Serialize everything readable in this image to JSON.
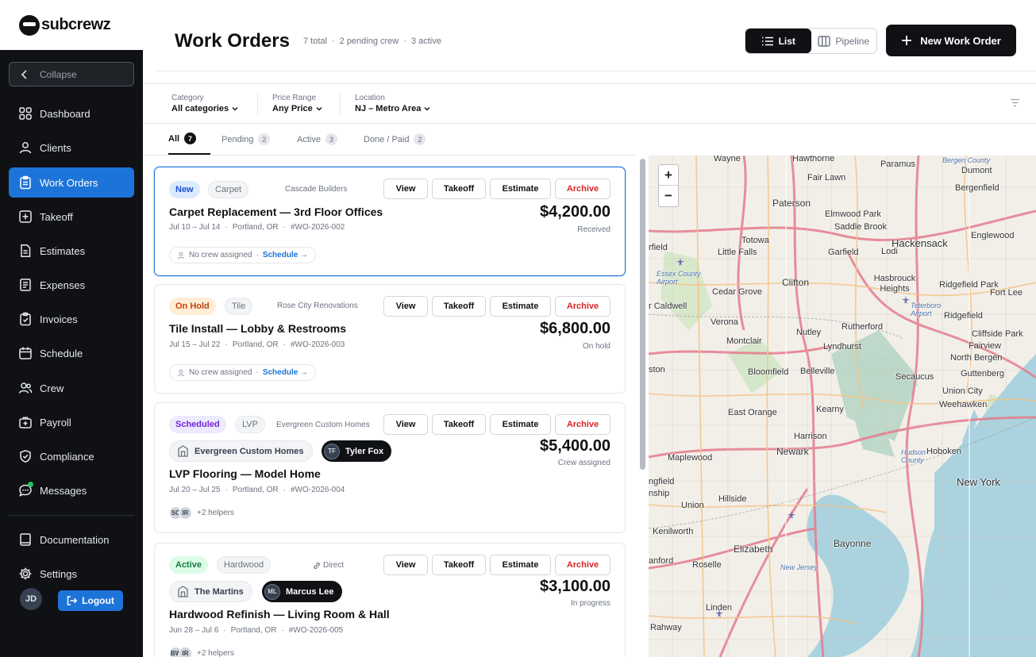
{
  "brand": {
    "name": "subcrewz"
  },
  "sidebar": {
    "collapse_label": "Collapse",
    "items": [
      {
        "label": "Dashboard",
        "icon": "dashboard-icon"
      },
      {
        "label": "Clients",
        "icon": "clients-icon"
      },
      {
        "label": "Work Orders",
        "icon": "clipboard-icon",
        "active": true
      },
      {
        "label": "Takeoff",
        "icon": "plus-square-icon"
      },
      {
        "label": "Estimates",
        "icon": "document-icon"
      },
      {
        "label": "Expenses",
        "icon": "receipt-icon"
      },
      {
        "label": "Invoices",
        "icon": "invoice-icon"
      },
      {
        "label": "Schedule",
        "icon": "calendar-icon"
      },
      {
        "label": "Crew",
        "icon": "crew-icon"
      },
      {
        "label": "Payroll",
        "icon": "payroll-icon"
      },
      {
        "label": "Compliance",
        "icon": "shield-icon"
      },
      {
        "label": "Messages",
        "icon": "message-icon",
        "unread_dot": true
      }
    ],
    "bottom_items": [
      {
        "label": "Documentation",
        "icon": "book-icon"
      },
      {
        "label": "Settings",
        "icon": "gear-icon"
      }
    ],
    "user_initials": "JD",
    "logout_label": "Logout"
  },
  "header": {
    "title": "Work Orders",
    "stats": [
      "7 total",
      "·",
      "2 pending crew",
      "·",
      "3 active"
    ],
    "view_list": "List",
    "view_pipeline": "Pipeline",
    "new_button": "New Work Order"
  },
  "filters": [
    {
      "label": "Category",
      "value": "All categories"
    },
    {
      "label": "Price Range",
      "value": "Any Price"
    },
    {
      "label": "Location",
      "value": "NJ – Metro Area"
    }
  ],
  "tabs": [
    {
      "label": "All",
      "count": "7",
      "active": true
    },
    {
      "label": "Pending",
      "count": "2"
    },
    {
      "label": "Active",
      "count": "3"
    },
    {
      "label": "Done / Paid",
      "count": "2"
    }
  ],
  "card_actions": {
    "view": "View",
    "takeoff": "Takeoff",
    "estimate": "Estimate",
    "archive": "Archive"
  },
  "cards": [
    {
      "status": "New",
      "status_bg": "#dbeafe",
      "status_color": "#1d4ed8",
      "category": "Carpet",
      "client": "Cascade Builders",
      "title": "Carpet Replacement — 3rd Floor Offices",
      "dates": "Jul 10 – Jul 14",
      "city": "Portland, OR",
      "wo": "#WO-2026-002",
      "price": "$4,200.00",
      "price_status": "Received",
      "crew_none": "No crew assigned",
      "schedule": "Schedule →"
    },
    {
      "status": "On Hold",
      "status_bg": "#ffedd5",
      "status_color": "#c2410c",
      "category": "Tile",
      "client": "Rose City Renovations",
      "title": "Tile Install — Lobby & Restrooms",
      "dates": "Jul 15 – Jul 22",
      "city": "Portland, OR",
      "wo": "#WO-2026-003",
      "price": "$6,800.00",
      "price_status": "On hold",
      "crew_none": "No crew assigned",
      "schedule": "Schedule →"
    },
    {
      "status": "Scheduled",
      "status_bg": "#ede9fe",
      "status_color": "#6d28d9",
      "category": "LVP",
      "client": "Evergreen Custom Homes",
      "client_pill": "Evergreen Custom Homes",
      "lead_initials": "TF",
      "lead_name": "Tyler Fox",
      "title": "LVP Flooring — Model Home",
      "dates": "Jul 20 – Jul 25",
      "city": "Portland, OR",
      "wo": "#WO-2026-004",
      "price": "$5,400.00",
      "price_status": "Crew assigned",
      "helper_initials": [
        "SO",
        "IR"
      ],
      "helpers": "+2 helpers"
    },
    {
      "status": "Active",
      "status_bg": "#dcfce7",
      "status_color": "#15803d",
      "category": "Hardwood",
      "client": "Direct",
      "client_pill": "The Martins",
      "lead_initials": "ML",
      "lead_name": "Marcus Lee",
      "title": "Hardwood Refinish — Living Room & Hall",
      "dates": "Jun 28 – Jul 6",
      "city": "Portland, OR",
      "wo": "#WO-2026-005",
      "price": "$3,100.00",
      "price_status": "In progress",
      "helper_initials": [
        "BW",
        "IR"
      ],
      "helpers": "+2 helpers"
    }
  ],
  "map": {
    "zoom_in": "+",
    "zoom_out": "−",
    "labels": [
      "Wayne",
      "Hawthorne",
      "Paramus",
      "Bergen County",
      "Dumont",
      "Bergenfield",
      "Fair Lawn",
      "Paterson",
      "Elmwood Park",
      "Saddle Brook",
      "Hackensack",
      "Englewood",
      "Totowa",
      "rfield",
      "Little Falls",
      "Garfield",
      "Lodi",
      "Essex County Airport",
      "Clifton",
      "Hasbrouck Heights",
      "Ridgefield Park",
      "Fort Lee",
      "r Caldwell",
      "Cedar Grove",
      "Teterboro Airport",
      "Ridgefield",
      "Verona",
      "Nutley",
      "Rutherford",
      "Cliffside Park",
      "Montclair",
      "Lyndhurst",
      "Fairview",
      "North Bergen",
      "ston",
      "Bloomfield",
      "Belleville",
      "Secaucus",
      "Guttenberg",
      "Union City",
      "East Orange",
      "Kearny",
      "Weehawken",
      "Harrison",
      "Hoboken",
      "Maplewood",
      "Newark",
      "Hudson County",
      "ngfield",
      "nship",
      "Hillside",
      "New York",
      "Union",
      "Kenilworth",
      "Elizabeth",
      "Bayonne",
      "anford",
      "Roselle",
      "New Jersey",
      "Linden",
      "Rahway"
    ]
  }
}
